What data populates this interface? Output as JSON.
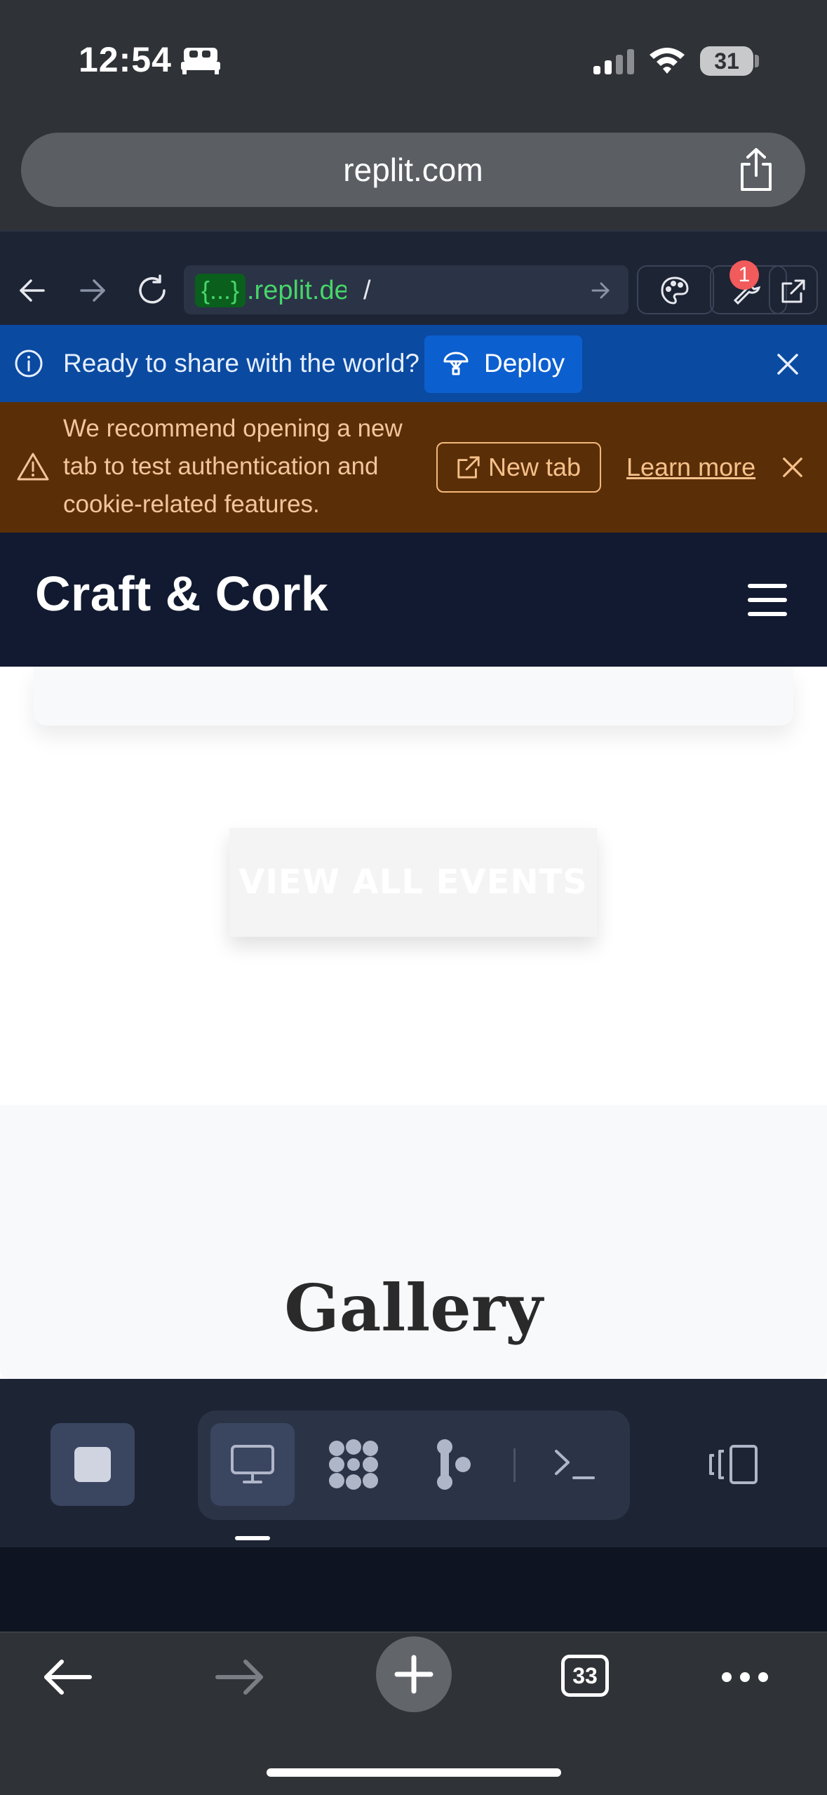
{
  "status_bar": {
    "time": "12:54",
    "battery": "31",
    "icons": [
      "bed-icon",
      "signal-icon",
      "wifi-icon",
      "battery-icon"
    ]
  },
  "safari": {
    "url": "replit.com",
    "tab_count": "33"
  },
  "replit_toolbar": {
    "address_chip": "{...}",
    "address_host": ".replit.de",
    "address_path": "/",
    "tools_badge": "1"
  },
  "deploy_banner": {
    "text": "Ready to share with the world?",
    "button": "Deploy"
  },
  "warning_banner": {
    "text": "We recommend opening a new tab to test authentication and cookie-related features.",
    "new_tab_button": "New tab",
    "learn_more": "Learn more"
  },
  "site": {
    "brand": "Craft & Cork",
    "view_all_events": "VIEW ALL EVENTS",
    "gallery_title": "Gallery"
  },
  "colors": {
    "deploy_banner": "#0a4aa1",
    "warning_banner": "#5a2f08",
    "site_header": "#111a30",
    "address_green": "#46d66a"
  }
}
